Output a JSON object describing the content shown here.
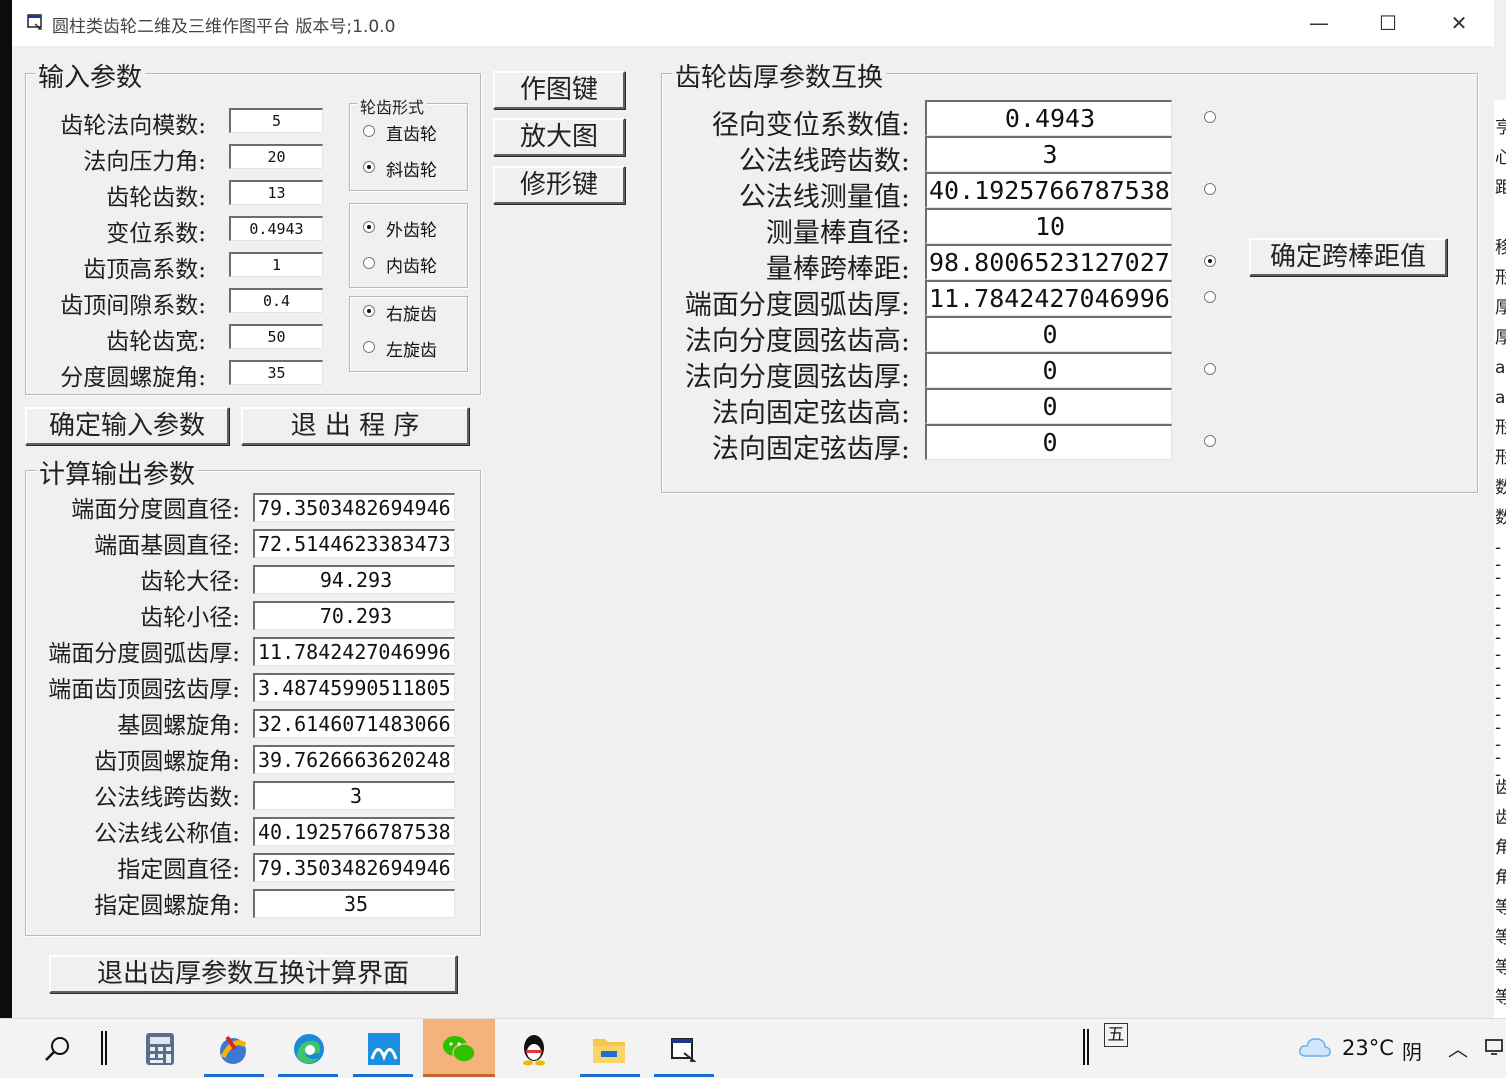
{
  "window": {
    "title": "圆柱类齿轮二维及三维作图平台 版本号;1.0.0",
    "controls": [
      "—",
      "☐",
      "✕"
    ]
  },
  "input_group": {
    "title": "输入参数",
    "fields": [
      {
        "label": "齿轮法向模数:",
        "value": "5"
      },
      {
        "label": "法向压力角:",
        "value": "20"
      },
      {
        "label": "齿轮齿数:",
        "value": "13"
      },
      {
        "label": "变位系数:",
        "value": "0.4943"
      },
      {
        "label": "齿顶高系数:",
        "value": "1"
      },
      {
        "label": "齿顶间隙系数:",
        "value": "0.4"
      },
      {
        "label": "齿轮齿宽:",
        "value": "50"
      },
      {
        "label": "分度圆螺旋角:",
        "value": "35"
      }
    ],
    "tooth_form": {
      "title": "轮齿形式",
      "options": [
        "直齿轮",
        "斜齿轮"
      ],
      "selected": 1
    },
    "gear_type": {
      "options": [
        "外齿轮",
        "内齿轮"
      ],
      "selected": 0
    },
    "helix_dir": {
      "options": [
        "右旋齿",
        "左旋齿"
      ],
      "selected": 0
    }
  },
  "buttons": {
    "draw": "作图键",
    "zoom": "放大图",
    "modify": "修形键",
    "confirm_input": "确定输入参数",
    "exit_program": "退 出 程 序",
    "exit_thickness": "退出齿厚参数互换计算界面",
    "confirm_pin": "确定跨棒距值"
  },
  "output_group": {
    "title": "计算输出参数",
    "fields": [
      {
        "label": "端面分度圆直径:",
        "value": "79.3503482694946"
      },
      {
        "label": "端面基圆直径:",
        "value": "72.5144623383473"
      },
      {
        "label": "齿轮大径:",
        "value": "94.293"
      },
      {
        "label": "齿轮小径:",
        "value": "70.293"
      },
      {
        "label": "端面分度圆弧齿厚:",
        "value": "11.7842427046996"
      },
      {
        "label": "端面齿顶圆弦齿厚:",
        "value": "3.48745990511805"
      },
      {
        "label": "基圆螺旋角:",
        "value": "32.6146071483066"
      },
      {
        "label": "齿顶圆螺旋角:",
        "value": "39.7626663620248"
      },
      {
        "label": "公法线跨齿数:",
        "value": "3"
      },
      {
        "label": "公法线公称值:",
        "value": "40.1925766787538"
      },
      {
        "label": "指定圆直径:",
        "value": "79.3503482694946"
      },
      {
        "label": "指定圆螺旋角:",
        "value": "35"
      }
    ]
  },
  "thickness_group": {
    "title": "齿轮齿厚参数互换",
    "selected_radio": "量棒跨棒距:",
    "fields": [
      {
        "label": "径向变位系数值:",
        "value": "0.4943",
        "radio": true
      },
      {
        "label": "公法线跨齿数:",
        "value": "3",
        "radio": false
      },
      {
        "label": "公法线测量值:",
        "value": "40.1925766787538",
        "radio": true
      },
      {
        "label": "测量棒直径:",
        "value": "10",
        "radio": false
      },
      {
        "label": "量棒跨棒距:",
        "value": "98.8006523127027",
        "radio": true
      },
      {
        "label": "端面分度圆弧齿厚:",
        "value": "11.7842427046996",
        "radio": true
      },
      {
        "label": "法向分度圆弦齿高:",
        "value": "0",
        "radio": false
      },
      {
        "label": "法向分度圆弦齿厚:",
        "value": "0",
        "radio": true
      },
      {
        "label": "法向固定弦齿高:",
        "value": "0",
        "radio": false
      },
      {
        "label": "法向固定弦齿厚:",
        "value": "0",
        "radio": true
      }
    ]
  },
  "background_glyphs": [
    "亨",
    "心",
    "距",
    "",
    "移",
    "形",
    "厚",
    "厚",
    "a-",
    "a-",
    "形",
    "形",
    "数",
    "数",
    "--",
    "--",
    "--",
    "--",
    "--",
    "--",
    "--",
    "--",
    "齿",
    "齿",
    "角",
    "角",
    "等",
    "等",
    "等",
    "等"
  ],
  "taskbar": {
    "ime_label": "五",
    "weather_temp": "23°C",
    "weather_desc": "阴",
    "icons": [
      "search-icon",
      "calculator-icon",
      "app-icon",
      "edge-icon",
      "app2-icon",
      "wechat-icon",
      "qq-icon",
      "folder-icon",
      "window-app-icon"
    ]
  }
}
